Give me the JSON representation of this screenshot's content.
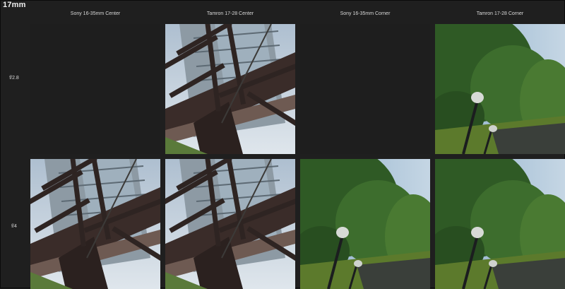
{
  "title": "17mm",
  "columns": [
    "Sony 16-35mm Center",
    "Tamron 17-28 Center",
    "Sony 16-35mm Corner",
    "Tamron 17-28 Corner"
  ],
  "rows": [
    {
      "label": "f/2.8",
      "cells": [
        "empty",
        "bridge-center",
        "empty",
        "trees-corner"
      ]
    },
    {
      "label": "f/4",
      "cells": [
        "bridge-center",
        "bridge-center",
        "trees-corner",
        "trees-corner"
      ]
    }
  ],
  "colors": {
    "background": "#1f1f1f",
    "sky": "#b9ccdc",
    "steel": "#3b2d2a",
    "building": "#8c9aa6",
    "foliage": "#3e6a2c",
    "grass": "#5f7a2d"
  }
}
